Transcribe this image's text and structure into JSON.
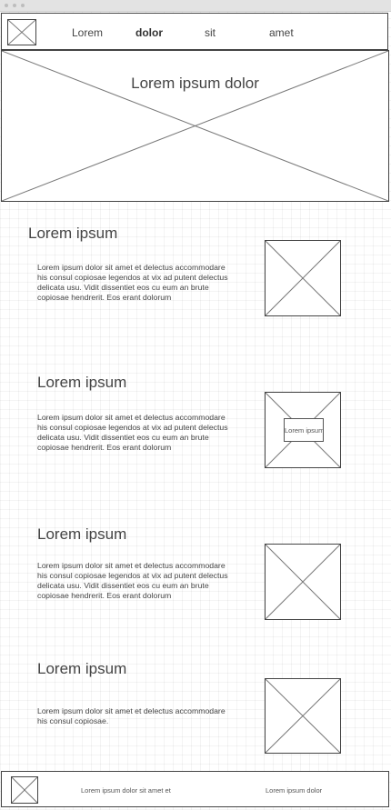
{
  "nav": {
    "links": [
      "Lorem",
      "dolor",
      "sit",
      "amet"
    ],
    "active_index": 1
  },
  "hero": {
    "title": "Lorem ipsum dolor"
  },
  "sections": [
    {
      "title": "Lorem ipsum",
      "text": "Lorem ipsum dolor sit amet et delectus accommodare his consul copiosae legendos at vix ad putent delectus delicata usu. Vidit dissentiet eos cu eum an brute copiosae hendrerit. Eos erant dolorum"
    },
    {
      "title": "Lorem ipsum",
      "text": "Lorem ipsum dolor sit amet et delectus accommodare his consul copiosae legendos at vix ad putent delectus delicata usu. Vidit dissentiet eos cu eum an brute copiosae hendrerit. Eos erant dolorum",
      "image_label": "Lorem ipsum"
    },
    {
      "title": "Lorem ipsum",
      "text": "Lorem ipsum dolor sit amet et delectus accommodare his consul copiosae legendos at vix ad putent delectus delicata usu. Vidit dissentiet eos cu eum an brute copiosae hendrerit. Eos erant dolorum"
    },
    {
      "title": "Lorem ipsum",
      "text": "Lorem ipsum dolor sit amet et delectus accommodare his consul copiosae."
    }
  ],
  "footer": {
    "left_text": "Lorem ipsum dolor sit amet et",
    "right_text": "Lorem ipsum dolor"
  }
}
